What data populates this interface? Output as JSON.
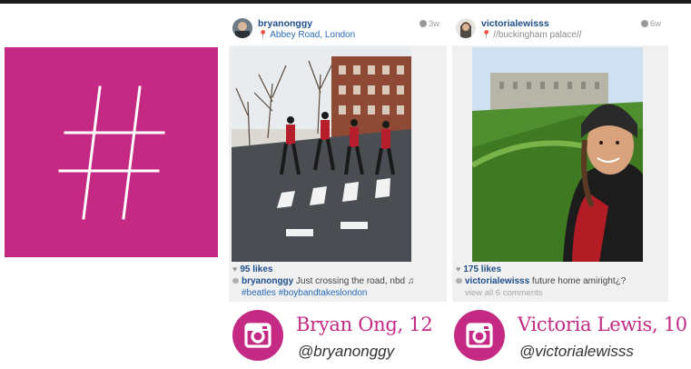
{
  "colors": {
    "accent": "#c42a84",
    "link": "#1e4f8a"
  },
  "hashtag_panel": {
    "icon": "hashtag-icon"
  },
  "posts": [
    {
      "username": "bryanonggy",
      "location": "Abbey Road, London",
      "age": "3w",
      "likes": "95 likes",
      "caption_user": "bryanonggy",
      "caption_text": " Just crossing the road, nbd ♫",
      "hashtags": "#beatles #boybandtakeslondon",
      "photo": "abbey-road-crossing-photo"
    },
    {
      "username": "victorialewisss",
      "location": "//buckingham palace//",
      "age": "6w",
      "likes": "175 likes",
      "caption_user": "victorialewisss",
      "caption_text": " future home amiright¿?",
      "view_all": "view all 6 comments",
      "photo": "buckingham-palace-selfie-photo"
    }
  ],
  "credits": [
    {
      "name": "Bryan Ong, 12",
      "handle": "@bryanonggy",
      "icon": "instagram-icon"
    },
    {
      "name": "Victoria Lewis, 10",
      "handle": "@victorialewisss",
      "icon": "instagram-icon"
    }
  ]
}
